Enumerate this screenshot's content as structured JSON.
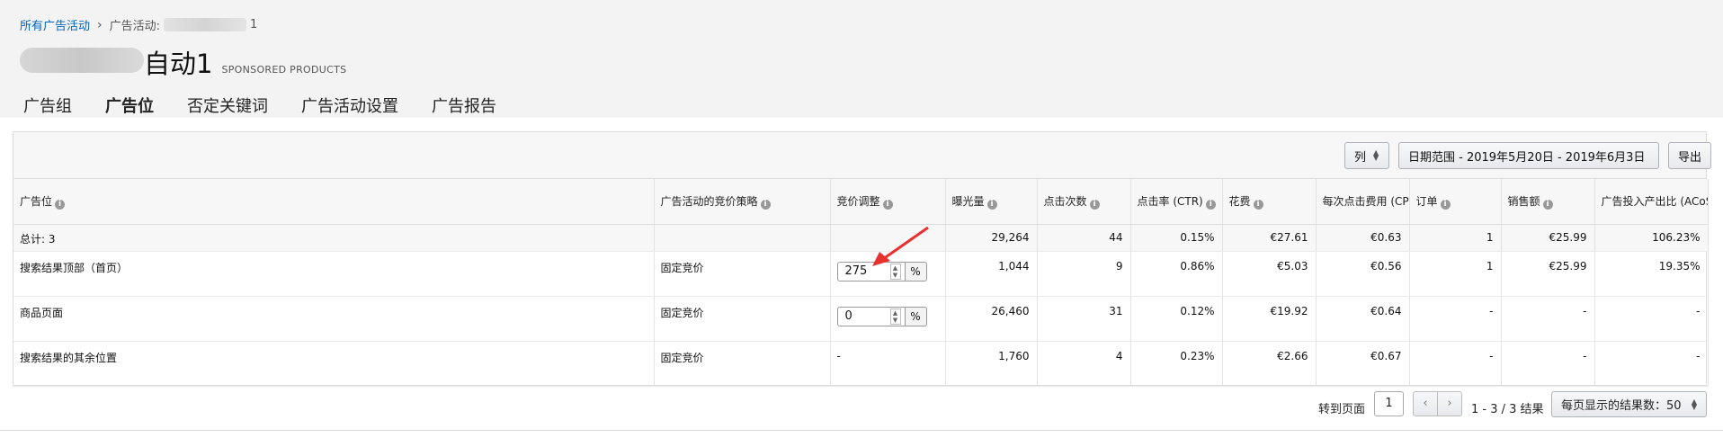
{
  "breadcrumb": {
    "root": "所有广告活动",
    "separator": "›",
    "current_prefix": "广告活动:",
    "current_suffix": "1"
  },
  "campaign": {
    "title_suffix": "自动1",
    "type_label": "SPONSORED PRODUCTS"
  },
  "tabs": [
    {
      "label": "广告组",
      "active": false
    },
    {
      "label": "广告位",
      "active": true
    },
    {
      "label": "否定关键词",
      "active": false
    },
    {
      "label": "广告活动设置",
      "active": false
    },
    {
      "label": "广告报告",
      "active": false
    }
  ],
  "toolbar": {
    "columns_label": "列",
    "date_range_label": "日期范围 - 2019年5月20日 - 2019年6月3日",
    "export_label": "导出"
  },
  "table": {
    "headers": [
      "广告位",
      "广告活动的竞价策略",
      "竞价调整",
      "曝光量",
      "点击次数",
      "点击率 (CTR)",
      "花费",
      "每次点击费用 (CPC)",
      "订单",
      "销售额",
      "广告投入产出比 (ACoS)"
    ],
    "total": {
      "label": "总计: 3",
      "impressions": "29,264",
      "clicks": "44",
      "ctr": "0.15%",
      "spend": "€27.61",
      "cpc": "€0.63",
      "orders": "1",
      "sales": "€25.99",
      "acos": "106.23%"
    },
    "rows": [
      {
        "placement": "搜索结果顶部（首页）",
        "strategy": "固定竞价",
        "bid": "275",
        "bid_unit": "%",
        "impressions": "1,044",
        "clicks": "9",
        "ctr": "0.86%",
        "spend": "€5.03",
        "cpc": "€0.56",
        "orders": "1",
        "sales": "€25.99",
        "acos": "19.35%"
      },
      {
        "placement": "商品页面",
        "strategy": "固定竞价",
        "bid": "0",
        "bid_unit": "%",
        "impressions": "26,460",
        "clicks": "31",
        "ctr": "0.12%",
        "spend": "€19.92",
        "cpc": "€0.64",
        "orders": "-",
        "sales": "-",
        "acos": "-"
      },
      {
        "placement": "搜索结果的其余位置",
        "strategy": "固定竞价",
        "bid": "-",
        "impressions": "1,760",
        "clicks": "4",
        "ctr": "0.23%",
        "spend": "€2.66",
        "cpc": "€0.67",
        "orders": "-",
        "sales": "-",
        "acos": "-"
      }
    ]
  },
  "pager": {
    "goto_label": "转到页面",
    "page": "1",
    "range": "1 - 3 / 3 结果",
    "page_size_label": "每页显示的结果数：50"
  },
  "icons": {
    "info": "info-icon",
    "prev": "chevron-left-icon",
    "next": "chevron-right-icon",
    "sort": "up-down-icon"
  },
  "colors": {
    "link": "#0066c0",
    "active_tab_underline": "#1e6fb0",
    "annotation_arrow": "#e8312f"
  }
}
